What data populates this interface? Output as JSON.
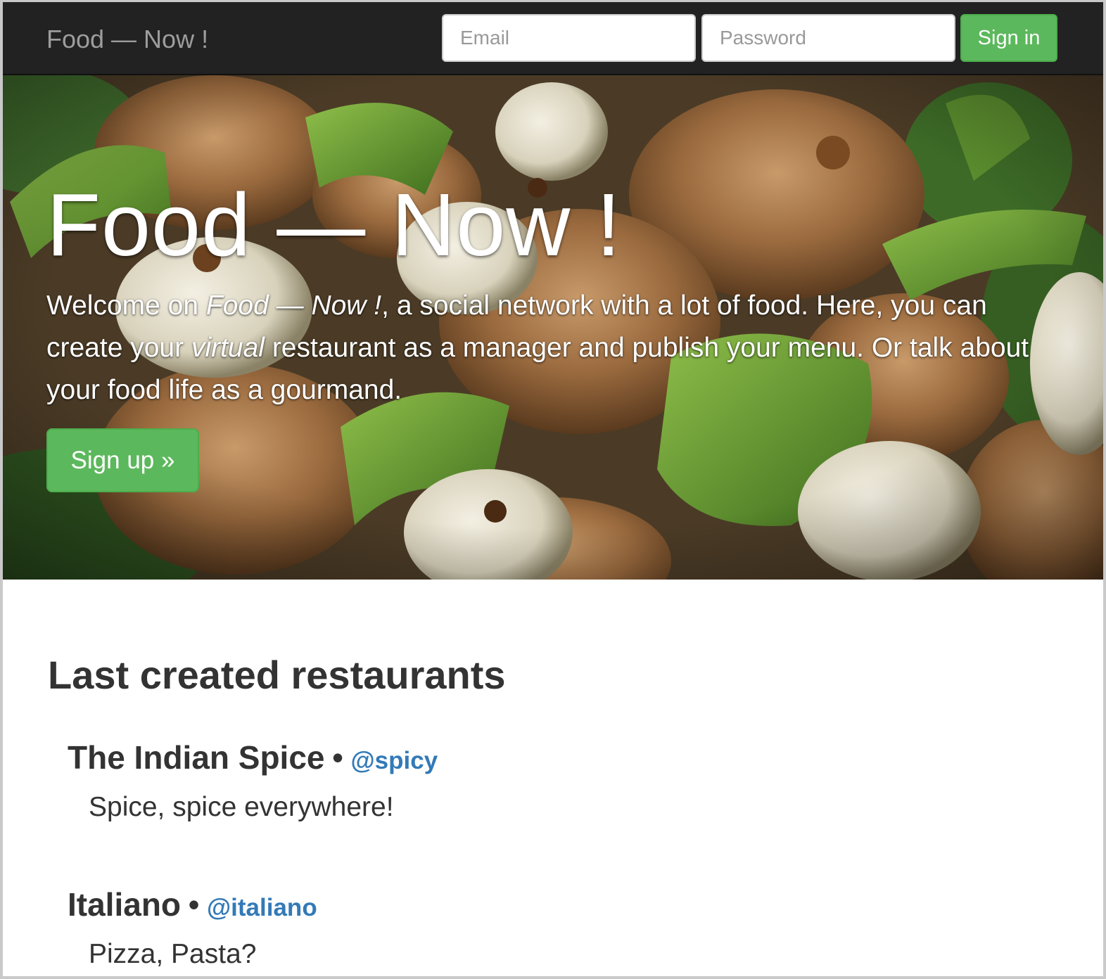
{
  "navbar": {
    "brand": "Food — Now !",
    "email_placeholder": "Email",
    "password_placeholder": "Password",
    "signin_label": "Sign in"
  },
  "hero": {
    "title": "Food — Now !",
    "text_part1": "Welcome on ",
    "text_italic1": "Food — Now !",
    "text_part2": ", a social network with a lot of food. Here, you can create your ",
    "text_italic2": "virtual",
    "text_part3": " restaurant as a manager and publish your menu. Or talk about your food life as a gourmand.",
    "signup_label": "Sign up »"
  },
  "main": {
    "section_title": "Last created restaurants",
    "restaurants": [
      {
        "name": "The Indian Spice",
        "separator": "•",
        "handle": "@spicy",
        "description": "Spice, spice everywhere!"
      },
      {
        "name": "Italiano",
        "separator": "•",
        "handle": "@italiano",
        "description": "Pizza, Pasta?"
      }
    ]
  },
  "colors": {
    "navbar_bg": "#222222",
    "brand_text": "#9d9d9d",
    "success_green": "#5cb85c",
    "link_blue": "#337ab7",
    "heading_text": "#333333"
  }
}
